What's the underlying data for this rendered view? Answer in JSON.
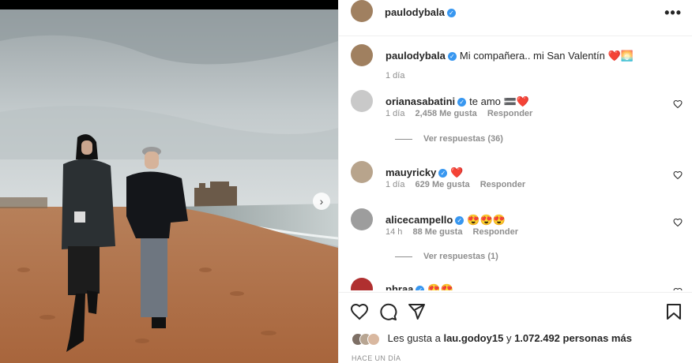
{
  "post": {
    "author": "paulodybala",
    "caption_author": "paulodybala",
    "caption": "Mi compañera.. mi San Valentín ❤️🌅",
    "caption_time": "1 día"
  },
  "comments": [
    {
      "user": "orianasabatini",
      "text": "te amo 🟰❤️",
      "time": "1 día",
      "likes": "2,458 Me gusta",
      "reply": "Responder",
      "view_replies": "Ver respuestas (36)"
    },
    {
      "user": "mauyricky",
      "text": "❤️",
      "time": "1 día",
      "likes": "629 Me gusta",
      "reply": "Responder"
    },
    {
      "user": "alicecampello",
      "text": "😍😍😍",
      "time": "14 h",
      "likes": "88 Me gusta",
      "reply": "Responder",
      "view_replies": "Ver respuestas (1)"
    },
    {
      "user": "phraa",
      "text": "😍😍"
    }
  ],
  "likes_line": {
    "prefix": "Les gusta a",
    "user": "lau.godoy15",
    "joiner": "y",
    "count": "1.072.492 personas más"
  },
  "post_date": "HACE UN DÍA",
  "icons": [
    "heart-icon",
    "comment-icon",
    "share-icon",
    "bookmark-icon",
    "more-icon",
    "verified-icon",
    "chevron-right-icon"
  ],
  "colors": {
    "verified": "#3897f0",
    "muted": "#8e8e8e",
    "text": "#262626"
  }
}
